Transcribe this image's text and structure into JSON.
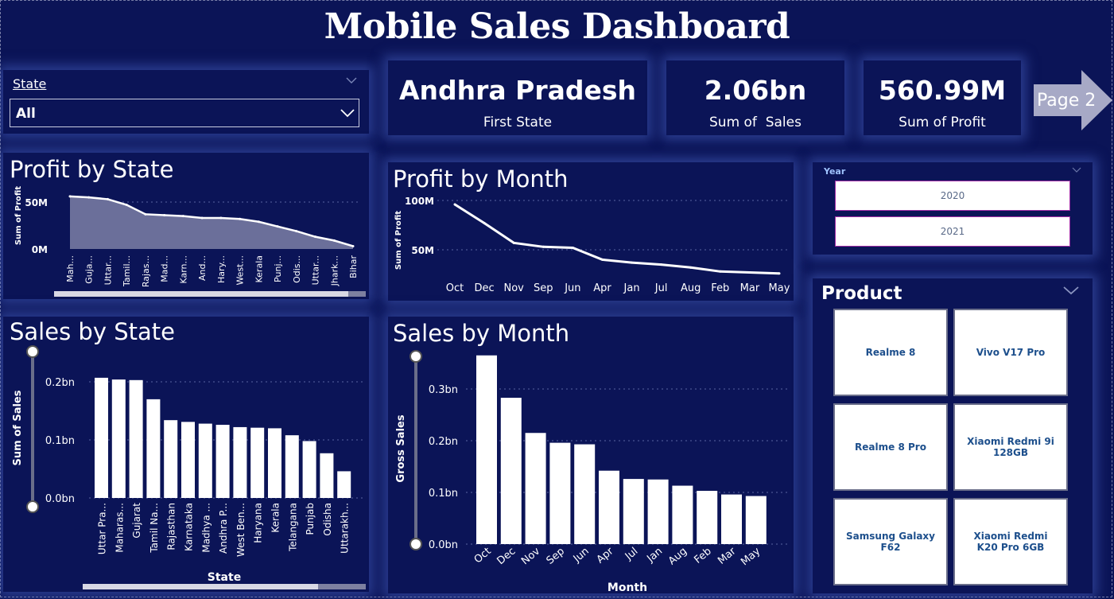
{
  "title": "Mobile Sales Dashboard",
  "state_filter": {
    "label": "State",
    "value": "All"
  },
  "cards": {
    "first_state": {
      "value": "Andhra Pradesh",
      "label": "First State"
    },
    "sales": {
      "value": "2.06bn",
      "label": "Sum of  Sales"
    },
    "profit": {
      "value": "560.99M",
      "label": "Sum of Profit"
    }
  },
  "page_nav": {
    "label": "Page 2"
  },
  "year_slicer": {
    "label": "Year",
    "options": [
      "2020",
      "2021"
    ]
  },
  "product_slicer": {
    "label": "Product",
    "options": [
      "Realme 8",
      "Vivo V17 Pro",
      "Realme 8 Pro",
      "Xiaomi Redmi 9i 128GB",
      "Samsung Galaxy F62",
      "Xiaomi Redmi K20 Pro 6GB"
    ]
  },
  "chart_data": [
    {
      "id": "profit_by_state",
      "type": "area",
      "title": "Profit by State",
      "ylabel": "Sum of Profit",
      "yticks": [
        "50M",
        "0M"
      ],
      "ylim": [
        0,
        72
      ],
      "categories": [
        "Mah...",
        "Guja...",
        "Uttar...",
        "Tamil...",
        "Rajas...",
        "Mad...",
        "Karn...",
        "And...",
        "Hary...",
        "West...",
        "Kerala",
        "Punj...",
        "Odis...",
        "Uttar...",
        "Jhark...",
        "Bihar"
      ],
      "values": [
        56,
        55,
        53,
        47,
        37,
        36,
        35,
        33,
        33,
        32,
        29,
        24,
        19,
        13,
        9,
        3
      ]
    },
    {
      "id": "profit_by_month",
      "type": "line",
      "title": "Profit by Month",
      "ylabel": "Sum of Profit",
      "yticks": [
        "100M",
        "50M"
      ],
      "ylim": [
        0,
        100
      ],
      "categories": [
        "Oct",
        "Dec",
        "Nov",
        "Sep",
        "Jun",
        "Apr",
        "Jan",
        "Jul",
        "Aug",
        "Feb",
        "Mar",
        "May"
      ],
      "values": [
        96,
        77,
        57,
        53,
        52,
        40,
        37,
        35,
        32,
        28,
        27,
        26
      ]
    },
    {
      "id": "sales_by_state",
      "type": "bar",
      "title": "Sales by State",
      "xlabel": "State",
      "ylabel": "Sum of Sales",
      "yticks": [
        "0.2bn",
        "0.1bn",
        "0.0bn"
      ],
      "ylim": [
        0,
        0.2
      ],
      "categories": [
        "Uttar Pra...",
        "Maharas...",
        "Gujarat",
        "Tamil Na...",
        "Rajasthan",
        "Karnataka",
        "Madhya ...",
        "Andhra P...",
        "West Ben...",
        "Haryana",
        "Kerala",
        "Telangana",
        "Punjab",
        "Odisha",
        "Uttarakh..."
      ],
      "values": [
        0.207,
        0.204,
        0.203,
        0.17,
        0.134,
        0.131,
        0.128,
        0.126,
        0.122,
        0.121,
        0.12,
        0.108,
        0.098,
        0.077,
        0.046
      ]
    },
    {
      "id": "sales_by_month",
      "type": "bar",
      "title": "Sales by Month",
      "xlabel": "Month",
      "ylabel": "Gross Sales",
      "yticks": [
        "0.3bn",
        "0.2bn",
        "0.1bn",
        "0.0bn"
      ],
      "ylim": [
        0,
        0.3
      ],
      "categories": [
        "Oct",
        "Dec",
        "Nov",
        "Sep",
        "Jun",
        "Apr",
        "Jul",
        "Jan",
        "Aug",
        "Feb",
        "Mar",
        "May"
      ],
      "values": [
        0.365,
        0.283,
        0.215,
        0.196,
        0.193,
        0.142,
        0.126,
        0.125,
        0.113,
        0.103,
        0.096,
        0.093
      ]
    }
  ]
}
